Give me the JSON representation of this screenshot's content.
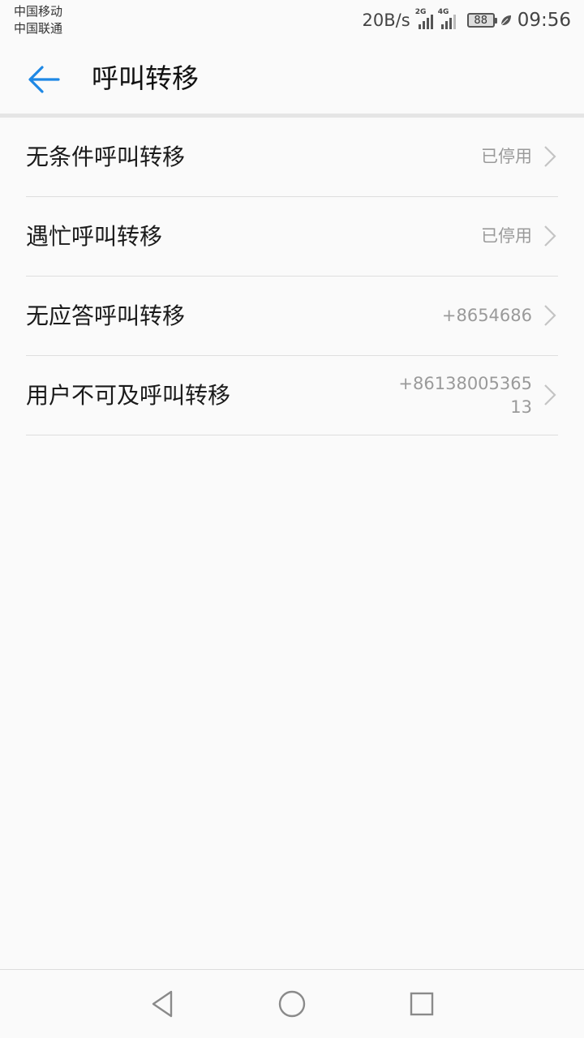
{
  "status_bar": {
    "carrier_1": "中国移动",
    "carrier_2": "中国联通",
    "net_speed": "20B/s",
    "signal_1_tag": "2G",
    "signal_2_tag": "4G",
    "battery": "88",
    "time": "09:56"
  },
  "app_bar": {
    "title": "呼叫转移",
    "back_icon": "arrow-left-icon"
  },
  "items": [
    {
      "label": "无条件呼叫转移",
      "value": "已停用"
    },
    {
      "label": "遇忙呼叫转移",
      "value": "已停用"
    },
    {
      "label": "无应答呼叫转移",
      "value": "+8654686"
    },
    {
      "label": "用户不可及呼叫转移",
      "value": "+8613800536513"
    }
  ],
  "colors": {
    "accent": "#1e88e5",
    "background": "#fafafa",
    "secondary_text": "#9a9a9a"
  }
}
